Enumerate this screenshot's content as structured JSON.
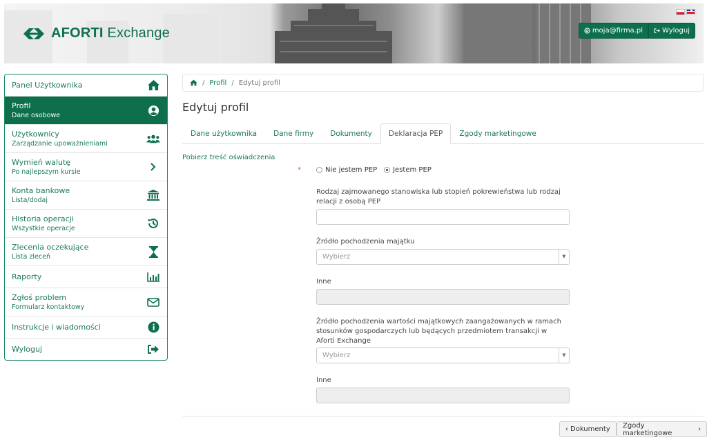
{
  "header": {
    "logo_brand": "AFORTI",
    "logo_product": "Exchange",
    "user_email": "moja@firma.pl",
    "logout_label": "Wyloguj",
    "accent": "#0d6f4c"
  },
  "sidebar": {
    "items": [
      {
        "title": "Panel Użytkownika",
        "subtitle": "",
        "icon": "home-icon"
      },
      {
        "title": "Profil",
        "subtitle": "Dane osobowe",
        "icon": "user-circle-icon"
      },
      {
        "title": "Użytkownicy",
        "subtitle": "Zarządzanie upoważnieniami",
        "icon": "users-icon"
      },
      {
        "title": "Wymień walutę",
        "subtitle": "Po najlepszym kursie",
        "icon": "chevron-right-icon"
      },
      {
        "title": "Konta bankowe",
        "subtitle": "Lista/dodaj",
        "icon": "bank-icon"
      },
      {
        "title": "Historia operacji",
        "subtitle": "Wszystkie operacje",
        "icon": "history-icon"
      },
      {
        "title": "Zlecenia oczekujące",
        "subtitle": "Lista zleceń",
        "icon": "hourglass-icon"
      },
      {
        "title": "Raporty",
        "subtitle": "",
        "icon": "bar-chart-icon"
      },
      {
        "title": "Zgłoś problem",
        "subtitle": "Formularz kontaktowy",
        "icon": "envelope-icon"
      },
      {
        "title": "Instrukcje i wiadomości",
        "subtitle": "",
        "icon": "info-icon"
      },
      {
        "title": "Wyloguj",
        "subtitle": "",
        "icon": "sign-out-icon"
      }
    ]
  },
  "breadcrumb": {
    "level1": "Profil",
    "level2": "Edytuj profil"
  },
  "page_title": "Edytuj profil",
  "tabs": [
    "Dane użytkownika",
    "Dane firmy",
    "Dokumenty",
    "Deklaracja PEP",
    "Zgody marketingowe"
  ],
  "form": {
    "download_link": "Pobierz treść oświadczenia",
    "required_mark": "*",
    "radio_not_pep": "Nie jestem PEP",
    "radio_is_pep": "Jestem PEP",
    "position_label": "Rodzaj zajmowanego stanowiska lub stopień pokrewieństwa lub rodzaj relacji z osobą PEP",
    "wealth_source_label": "Źródło pochodzenia majątku",
    "wealth_source_placeholder": "Wybierz",
    "other_label_1": "Inne",
    "assets_source_label": "Źródło pochodzenia wartości majątkowych zaangażowanych w ramach stosunków gospodarczych lub będących przedmiotem transakcji w Aforti Exchange",
    "assets_source_placeholder": "Wybierz",
    "other_label_2": "Inne"
  },
  "footer_nav": {
    "prev_label": "Dokumenty",
    "next_label": "Zgody marketingowe"
  }
}
